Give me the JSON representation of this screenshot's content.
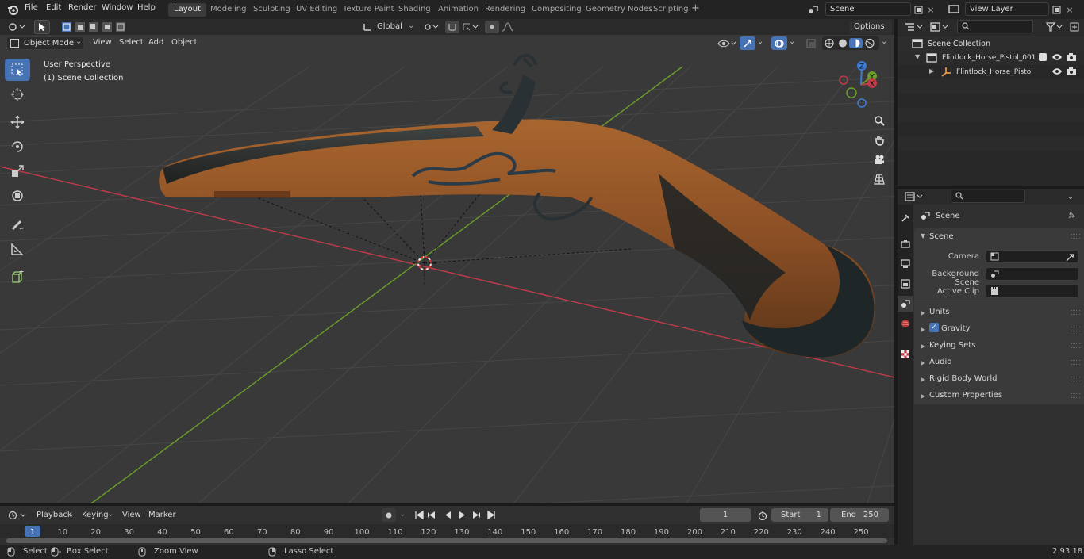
{
  "topbar": {
    "menus": [
      "File",
      "Edit",
      "Render",
      "Window",
      "Help"
    ],
    "workspaces": [
      "Layout",
      "Modeling",
      "Sculpting",
      "UV Editing",
      "Texture Paint",
      "Shading",
      "Animation",
      "Rendering",
      "Compositing",
      "Geometry Nodes",
      "Scripting"
    ],
    "active_workspace": "Layout",
    "scene_name": "Scene",
    "view_layer": "View Layer"
  },
  "tool_header": {
    "orientation": "Global",
    "options_label": "Options"
  },
  "viewport_header": {
    "mode": "Object Mode",
    "menus": [
      "View",
      "Select",
      "Add",
      "Object"
    ]
  },
  "viewport": {
    "overlay_line1": "User Perspective",
    "overlay_line2": "(1) Scene Collection",
    "gizmo_axes": [
      "Z",
      "Y",
      "X"
    ]
  },
  "outliner": {
    "root": "Scene Collection",
    "items": [
      {
        "label": "Flintlock_Horse_Pistol_001",
        "level": 1
      },
      {
        "label": "Flintlock_Horse_Pistol",
        "level": 2
      }
    ]
  },
  "properties": {
    "context": "Scene",
    "section_title": "Scene",
    "fields": [
      {
        "label": "Camera",
        "value": ""
      },
      {
        "label": "Background Scene",
        "value": ""
      },
      {
        "label": "Active Clip",
        "value": ""
      }
    ],
    "panels": [
      "Units",
      "Gravity",
      "Keying Sets",
      "Audio",
      "Rigid Body World",
      "Custom Properties"
    ]
  },
  "timeline": {
    "menus": [
      "Playback",
      "Keying",
      "View",
      "Marker"
    ],
    "current_frame": "1",
    "start_label": "Start",
    "start_value": "1",
    "end_label": "End",
    "end_value": "250",
    "ruler": [
      "1",
      "10",
      "20",
      "30",
      "40",
      "50",
      "60",
      "70",
      "80",
      "90",
      "100",
      "110",
      "120",
      "130",
      "140",
      "150",
      "160",
      "170",
      "180",
      "190",
      "200",
      "210",
      "220",
      "230",
      "240",
      "250"
    ]
  },
  "statusbar": {
    "select": "Select",
    "box_select": "Box Select",
    "zoom_view": "Zoom View",
    "lasso_select": "Lasso Select",
    "version": "2.93.18"
  },
  "colors": {
    "accent": "#4772b3",
    "x_axis": "#c23b4a",
    "y_axis": "#6a9e2b",
    "z_axis": "#3d7dd6",
    "wood": "#8b4f25"
  }
}
